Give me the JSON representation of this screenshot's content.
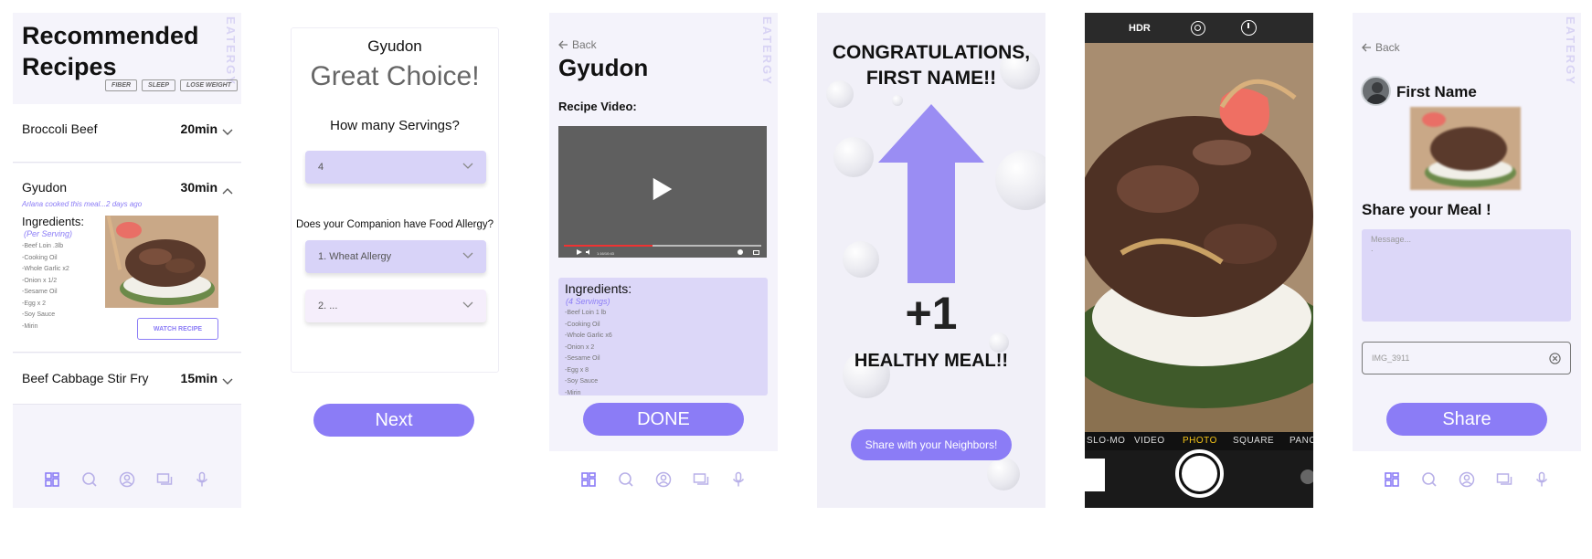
{
  "brand": "EATERGY",
  "nav": [
    "dashboard-icon",
    "search-icon",
    "profile-icon",
    "chat-icon",
    "mic-icon"
  ],
  "colors": {
    "accent": "#8b7cf6",
    "lavender_bg": "#f4f3fb",
    "select_bg": "#d8d3f8"
  },
  "screen1": {
    "title_line1": "Recommended",
    "title_line2": "Recipes",
    "tags": [
      "FIBER",
      "SLEEP",
      "LOSE WEIGHT"
    ],
    "recipes": [
      {
        "name": "Broccoli Beef",
        "time": "20min"
      },
      {
        "name": "Gyudon",
        "time": "30min"
      },
      {
        "name": "Beef Cabbage Stir Fry",
        "time": "15min"
      }
    ],
    "cooked_note": "Arlana cooked this meal...2 days ago",
    "ingredients_heading": "Ingredients:",
    "per_serving": "(Per Serving)",
    "ingredients": [
      "-Beef Loin .3lb",
      "-Cooking Oil",
      "-Whole Garlic x2",
      "-Onion x 1/2",
      "-Sesame Oil",
      "-Egg x 2",
      "-Soy Sauce",
      "-Mirin"
    ],
    "watch_button": "WATCH RECIPE"
  },
  "screen2": {
    "dish": "Gyudon",
    "headline": "Great Choice!",
    "servings_question": "How many Servings?",
    "servings_value": "4",
    "allergy_question": "Does your Companion have Food Allergy?",
    "allergy1": "1. Wheat Allergy",
    "allergy2": "2. ...",
    "next_button": "Next"
  },
  "screen3": {
    "back": "Back",
    "dish": "Gyudon",
    "video_label": "Recipe Video:",
    "video_time": "1:16/10:43",
    "ingredients_heading": "Ingredients:",
    "servings": "(4 Servings)",
    "ingredients": [
      "-Beef Loin 1 lb",
      "-Cooking Oil",
      "-Whole Garlic x6",
      "-Onion x 2",
      "-Sesame Oil",
      "-Egg x 8",
      "-Soy Sauce",
      "-Mirin"
    ],
    "done_button": "DONE"
  },
  "screen4": {
    "congrats_line1": "CONGRATULATIONS,",
    "congrats_line2": "FIRST NAME!!",
    "plus": "+1",
    "healthy": "HEALTHY MEAL!!",
    "share_button": "Share with your Neighbors!"
  },
  "screen5": {
    "hdr": "HDR",
    "modes": [
      "SLO-MO",
      "VIDEO",
      "PHOTO",
      "SQUARE",
      "PANO"
    ],
    "active_mode": "PHOTO"
  },
  "screen6": {
    "back": "Back",
    "user_name": "First Name",
    "share_title": "Share your Meal !",
    "message_placeholder": "Message...",
    "message_value": ".",
    "attachment": "IMG_3911",
    "share_button": "Share"
  }
}
